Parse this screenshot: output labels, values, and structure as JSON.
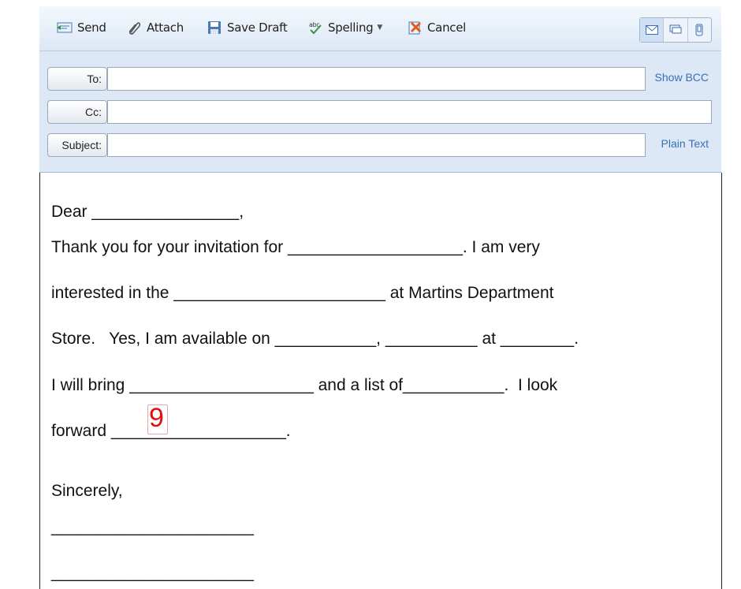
{
  "toolbar": {
    "send_label": "Send",
    "attach_label": "Attach",
    "save_draft_label": "Save Draft",
    "spelling_label": "Spelling",
    "cancel_label": "Cancel",
    "view_icons": [
      "envelope-icon",
      "chat-icon",
      "phone-icon"
    ]
  },
  "header": {
    "to_label": "To:",
    "cc_label": "Cc:",
    "subject_label": "Subject:",
    "to_value": "",
    "cc_value": "",
    "subject_value": "",
    "show_bcc_label": "Show BCC",
    "plain_text_label": "Plain Text"
  },
  "body": {
    "line1": "Dear ________________,",
    "line2": "Thank you for your invitation for ___________________. I am very",
    "line3": "interested in the _______________________ at Martins Department",
    "line4": "Store.   Yes, I am available on ___________, __________ at ________.",
    "line5": "I will bring ____________________ and a list of___________.  I look",
    "line6": "forward ___________________.",
    "line7": "Sincerely,",
    "line8": "______________________",
    "line9": "______________________",
    "active_field_value": "9"
  },
  "colors": {
    "toolbar_bg": "#e6eef8",
    "header_bg": "#dce8f6",
    "link": "#3a6fb8",
    "active_value": "#e01010"
  }
}
